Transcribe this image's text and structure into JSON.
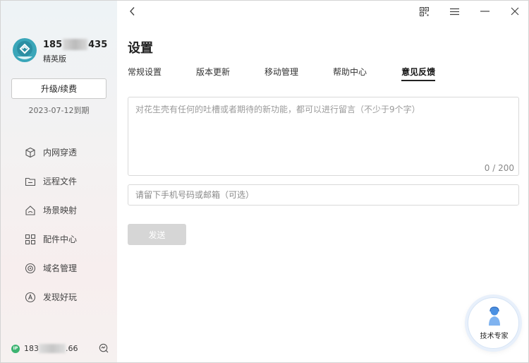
{
  "sidebar": {
    "user": {
      "phone_prefix": "185",
      "phone_suffix": "435",
      "edition": "精英版"
    },
    "upgrade_label": "升级/续费",
    "expire_text": "2023-07-12到期",
    "items": [
      {
        "label": "内网穿透",
        "icon": "cube-icon"
      },
      {
        "label": "远程文件",
        "icon": "folder-icon"
      },
      {
        "label": "场景映射",
        "icon": "house-icon"
      },
      {
        "label": "配件中心",
        "icon": "grid-icon"
      },
      {
        "label": "域名管理",
        "icon": "globe-icon"
      },
      {
        "label": "发现好玩",
        "icon": "compass-icon"
      }
    ],
    "ip": {
      "badge": "IP",
      "prefix": "183",
      "suffix": ".66"
    }
  },
  "main": {
    "title": "设置",
    "tabs": [
      {
        "label": "常规设置",
        "active": false
      },
      {
        "label": "版本更新",
        "active": false
      },
      {
        "label": "移动管理",
        "active": false
      },
      {
        "label": "帮助中心",
        "active": false
      },
      {
        "label": "意见反馈",
        "active": true
      }
    ],
    "feedback": {
      "placeholder": "对花生壳有任何的吐槽或者期待的新功能，都可以进行留言（不少于9个字）",
      "value": "",
      "counter": "0 / 200"
    },
    "contact": {
      "placeholder": "请留下手机号码或邮箱（可选）",
      "value": ""
    },
    "send_label": "发送",
    "expert_label": "技术专家"
  },
  "colors": {
    "accent": "#3aa6b9",
    "ip_badge": "#3cb371",
    "disabled_button": "#d6d6d6"
  }
}
